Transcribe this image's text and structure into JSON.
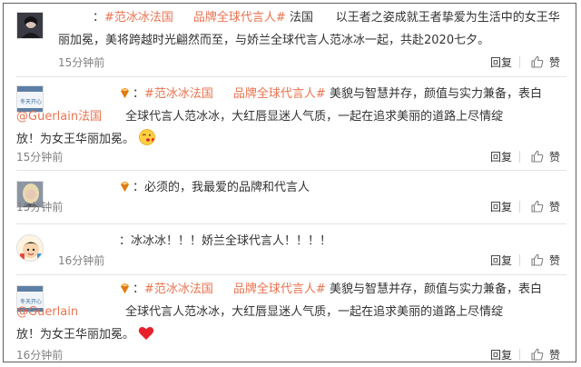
{
  "comments": [
    {
      "lines": {
        "l1_prefix": "：",
        "l1_tag1": "#范冰冰法国",
        "l1_tag2": "品牌全球代言人#",
        "l1_text": " 法国      以王者之姿成就王者挚爱为生活中的女王华",
        "l2_text": "丽加冕，美将跨越时光翩然而至，与娇兰全球代言人范冰冰一起，共赴2020七夕。"
      },
      "time": "15分钟前",
      "reply": "回复",
      "like": "赞"
    },
    {
      "lines": {
        "l1_prefix": "：",
        "l1_tag1": "#范冰冰法国",
        "l1_tag2": "品牌全球代言人#",
        "l1_text": " 美貌与智慧并存，颜值与实力兼备，表白",
        "l2_mention": "@Guerlain法国",
        "l2_text": "全球代言人范冰冰，大红唇显迷人气质，一起在追求美丽的道路上尽情绽",
        "l3_text": "放！为女王华丽加冕。"
      },
      "time": "15分钟前",
      "reply": "回复",
      "like": "赞"
    },
    {
      "lines": {
        "l1_text": "：必须的，我最爱的品牌和代言人"
      },
      "time": "15分钟前",
      "reply": "回复",
      "like": "赞"
    },
    {
      "lines": {
        "l1_text": "：冰冰冰！！！娇兰全球代言人！！！！"
      },
      "time": "16分钟前",
      "reply": "回复",
      "like": "赞"
    },
    {
      "lines": {
        "l1_prefix": "：",
        "l1_tag1": "#范冰冰法国",
        "l1_tag2": "品牌全球代言人#",
        "l1_text": " 美貌与智慧并存，颜值与实力兼备，表白",
        "l2_mention": "@Guerlain",
        "l2_text": "全球代言人范冰冰，大红唇显迷人气质，一起在追求美丽的道路上尽情绽",
        "l3_text": "放！为女王华丽加冕。"
      },
      "time": "16分钟前",
      "reply": "回复",
      "like": "赞"
    }
  ],
  "avatar_texts": {
    "c2": "冬天开心",
    "c5": "冬天开心"
  },
  "colors": {
    "link": "#eb7350",
    "text": "#333333",
    "meta": "#808080",
    "divider": "#e4e4e4",
    "heart": "#e8202a"
  },
  "icons": {
    "like": "thumbs-up-icon",
    "vip": "gem-icon",
    "emoji_kiss": "kiss-emoji-icon",
    "emoji_heart": "red-heart-icon"
  }
}
